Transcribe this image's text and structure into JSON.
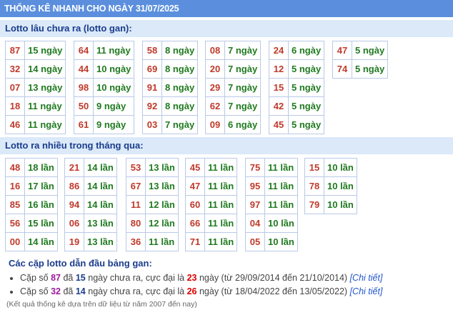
{
  "header": {
    "title": "THỐNG KÊ NHANH CHO NGÀY 31/07/2025"
  },
  "gan": {
    "title": "Lotto lâu chưa ra (lotto gan):",
    "groups": [
      [
        [
          "87",
          "15 ngày"
        ],
        [
          "32",
          "14 ngày"
        ],
        [
          "07",
          "13 ngày"
        ],
        [
          "18",
          "11 ngày"
        ],
        [
          "46",
          "11 ngày"
        ]
      ],
      [
        [
          "64",
          "11 ngày"
        ],
        [
          "44",
          "10 ngày"
        ],
        [
          "98",
          "10 ngày"
        ],
        [
          "50",
          "9 ngày"
        ],
        [
          "61",
          "9 ngày"
        ]
      ],
      [
        [
          "58",
          "8 ngày"
        ],
        [
          "69",
          "8 ngày"
        ],
        [
          "91",
          "8 ngày"
        ],
        [
          "92",
          "8 ngày"
        ],
        [
          "03",
          "7 ngày"
        ]
      ],
      [
        [
          "08",
          "7 ngày"
        ],
        [
          "20",
          "7 ngày"
        ],
        [
          "29",
          "7 ngày"
        ],
        [
          "62",
          "7 ngày"
        ],
        [
          "09",
          "6 ngày"
        ]
      ],
      [
        [
          "24",
          "6 ngày"
        ],
        [
          "12",
          "5 ngày"
        ],
        [
          "15",
          "5 ngày"
        ],
        [
          "42",
          "5 ngày"
        ],
        [
          "45",
          "5 ngày"
        ]
      ],
      [
        [
          "47",
          "5 ngày"
        ],
        [
          "74",
          "5 ngày"
        ]
      ]
    ]
  },
  "freq": {
    "title": "Lotto ra nhiều trong tháng qua:",
    "groups": [
      [
        [
          "48",
          "18 lần"
        ],
        [
          "16",
          "17 lần"
        ],
        [
          "85",
          "16 lần"
        ],
        [
          "56",
          "15 lần"
        ],
        [
          "00",
          "14 lần"
        ]
      ],
      [
        [
          "21",
          "14 lần"
        ],
        [
          "86",
          "14 lần"
        ],
        [
          "94",
          "14 lần"
        ],
        [
          "06",
          "13 lần"
        ],
        [
          "19",
          "13 lần"
        ]
      ],
      [
        [
          "53",
          "13 lần"
        ],
        [
          "67",
          "13 lần"
        ],
        [
          "11",
          "12 lần"
        ],
        [
          "80",
          "12 lần"
        ],
        [
          "36",
          "11 lần"
        ]
      ],
      [
        [
          "45",
          "11 lần"
        ],
        [
          "47",
          "11 lần"
        ],
        [
          "60",
          "11 lần"
        ],
        [
          "66",
          "11 lần"
        ],
        [
          "71",
          "11 lần"
        ]
      ],
      [
        [
          "75",
          "11 lần"
        ],
        [
          "95",
          "11 lần"
        ],
        [
          "97",
          "11 lần"
        ],
        [
          "04",
          "10 lần"
        ],
        [
          "05",
          "10 lần"
        ]
      ],
      [
        [
          "15",
          "10 lần"
        ],
        [
          "78",
          "10 lần"
        ],
        [
          "79",
          "10 lần"
        ]
      ]
    ]
  },
  "lead": {
    "title": "Các cặp lotto dẫn đầu bảng gan:",
    "items": [
      {
        "p1": "Cặp số ",
        "num": "87",
        "p2": " đã ",
        "days": "15",
        "p3": " ngày chưa ra, cực đại là ",
        "max": "23",
        "p4": " ngày (từ 29/09/2014 đến 21/10/2014) ",
        "link": "[Chi tiết]"
      },
      {
        "p1": "Cặp số ",
        "num": "32",
        "p2": " đã ",
        "days": "14",
        "p3": " ngày chưa ra, cực đại là ",
        "max": "26",
        "p4": " ngày (từ 18/04/2022 đến 13/05/2022) ",
        "link": "[Chi tiết]"
      }
    ]
  },
  "note": "(Kết quả thống kê dựa trên dữ liệu từ năm 2007 đến nay)"
}
